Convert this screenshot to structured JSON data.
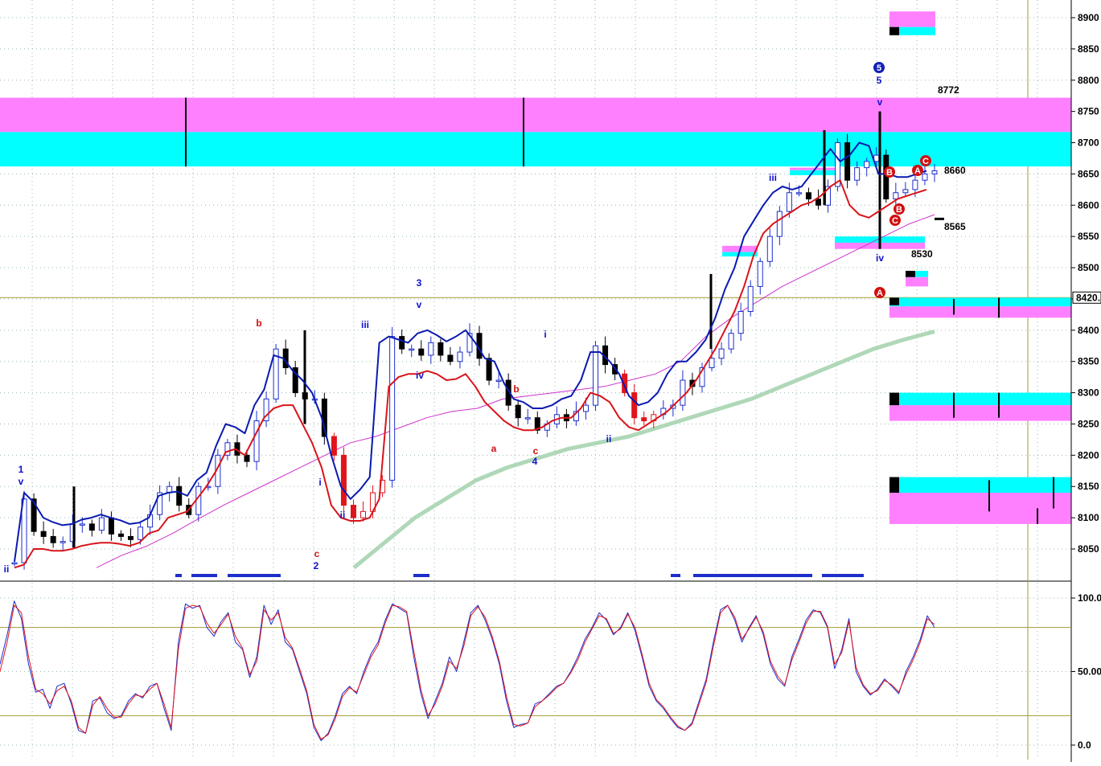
{
  "chart_data": [
    {
      "type": "candlestick",
      "panel": "price",
      "title": "",
      "ylim": [
        8000,
        8920
      ],
      "y_ticks": [
        "8050",
        "8100",
        "8150",
        "8200",
        "8250",
        "8300",
        "8350",
        "8400",
        "8450",
        "8500",
        "8550",
        "8600",
        "8650",
        "8700",
        "8750",
        "8800",
        "8850",
        "8900"
      ],
      "current_price_label": "8420.",
      "current_price": 8420,
      "grid": true,
      "colors": {
        "up_candle": "#1c2fcc",
        "down_candle": "#000000",
        "correction_candle": "#e0141b",
        "band_upper": "#0a1ab0",
        "band_lower": "#d9141b",
        "ma_medium": "#cc33cc",
        "ma_long": "#b0d8b8",
        "zone_magenta": "#ff80ff",
        "zone_cyan": "#00ffff",
        "hline": "#a39a36"
      },
      "horizontal_lines": [
        8420
      ],
      "zones": [
        {
          "from": 8717,
          "to": 8772,
          "color": "magenta"
        },
        {
          "from": 8662,
          "to": 8717,
          "color": "cyan"
        },
        {
          "from": 8885,
          "to": 8910,
          "color": "magenta"
        },
        {
          "from": 8872,
          "to": 8885,
          "color": "cyan"
        },
        {
          "from": 8648,
          "to": 8656,
          "color": "cyan"
        },
        {
          "from": 8530,
          "to": 8550,
          "color": "magenta/cyan"
        },
        {
          "from": 8525,
          "to": 8540,
          "color": "magenta/cyan"
        },
        {
          "from": 8468,
          "to": 8495,
          "color": "magenta/cyan"
        },
        {
          "from": 8420,
          "to": 8452,
          "color": "magenta/cyan"
        },
        {
          "from": 8255,
          "to": 8300,
          "color": "cyan/magenta"
        },
        {
          "from": 8090,
          "to": 8165,
          "color": "cyan/magenta"
        }
      ],
      "price_labels": [
        "8772",
        "8660",
        "8565",
        "8530"
      ],
      "wave_labels": [
        {
          "text": "ii",
          "color": "blue"
        },
        {
          "text": "1",
          "color": "blue"
        },
        {
          "text": "v",
          "color": "blue"
        },
        {
          "text": "b",
          "color": "red"
        },
        {
          "text": "c",
          "color": "red"
        },
        {
          "text": "2",
          "color": "blue"
        },
        {
          "text": "i",
          "color": "blue"
        },
        {
          "text": "ii",
          "color": "blue"
        },
        {
          "text": "iii",
          "color": "blue"
        },
        {
          "text": "3",
          "color": "blue"
        },
        {
          "text": "v",
          "color": "blue"
        },
        {
          "text": "iv",
          "color": "blue"
        },
        {
          "text": "a",
          "color": "red"
        },
        {
          "text": "b",
          "color": "red"
        },
        {
          "text": "c",
          "color": "red"
        },
        {
          "text": "4",
          "color": "blue"
        },
        {
          "text": "i",
          "color": "blue"
        },
        {
          "text": "ii",
          "color": "blue"
        },
        {
          "text": "iii",
          "color": "blue"
        },
        {
          "text": "5",
          "color": "blue"
        },
        {
          "text": "v",
          "color": "blue"
        },
        {
          "text": "iv",
          "color": "blue"
        }
      ],
      "circle_labels": [
        {
          "text": "5",
          "color": "blue"
        },
        {
          "text": "B",
          "color": "red"
        },
        {
          "text": "C",
          "color": "red"
        },
        {
          "text": "A",
          "color": "red"
        },
        {
          "text": "C",
          "color": "red"
        },
        {
          "text": "B",
          "color": "red"
        },
        {
          "text": "A",
          "color": "red"
        }
      ],
      "series_close": [
        8028,
        8130,
        8078,
        8070,
        8060,
        8062,
        8090,
        8090,
        8080,
        8100,
        8074,
        8070,
        8065,
        8085,
        8105,
        8140,
        8150,
        8120,
        8105,
        8150,
        8150,
        8200,
        8220,
        8200,
        8190,
        8255,
        8290,
        8370,
        8340,
        8300,
        8290,
        8290,
        8230,
        8200,
        8120,
        8100,
        8110,
        8140,
        8160,
        8390,
        8370,
        8370,
        8360,
        8380,
        8360,
        8350,
        8365,
        8395,
        8355,
        8320,
        8320,
        8280,
        8260,
        8260,
        8240,
        8250,
        8265,
        8255,
        8270,
        8280,
        8375,
        8345,
        8330,
        8300,
        8260,
        8255,
        8265,
        8275,
        8280,
        8320,
        8310,
        8340,
        8355,
        8370,
        8395,
        8430,
        8470,
        8510,
        8550,
        8590,
        8620,
        8620,
        8610,
        8600,
        8630,
        8700,
        8640,
        8660,
        8670,
        8680,
        8610,
        8620,
        8625,
        8640,
        8650,
        8655
      ],
      "band_upper": [
        8030,
        8140,
        8125,
        8100,
        8093,
        8088,
        8090,
        8097,
        8100,
        8105,
        8100,
        8096,
        8090,
        8092,
        8100,
        8135,
        8140,
        8142,
        8135,
        8160,
        8172,
        8215,
        8250,
        8245,
        8235,
        8280,
        8305,
        8360,
        8355,
        8335,
        8320,
        8300,
        8260,
        8200,
        8150,
        8130,
        8145,
        8165,
        8380,
        8390,
        8385,
        8380,
        8395,
        8400,
        8392,
        8382,
        8390,
        8400,
        8380,
        8355,
        8350,
        8315,
        8290,
        8285,
        8275,
        8275,
        8280,
        8290,
        8295,
        8320,
        8365,
        8365,
        8350,
        8330,
        8295,
        8280,
        8285,
        8300,
        8330,
        8350,
        8350,
        8365,
        8385,
        8420,
        8465,
        8500,
        8550,
        8575,
        8600,
        8620,
        8630,
        8625,
        8630,
        8650,
        8670,
        8690,
        8670,
        8680,
        8700,
        8695,
        8650,
        8650,
        8645,
        8645,
        8650,
        8655
      ],
      "band_lower": [
        8020,
        8025,
        8050,
        8050,
        8047,
        8047,
        8050,
        8055,
        8058,
        8060,
        8060,
        8058,
        8055,
        8060,
        8075,
        8080,
        8100,
        8105,
        8110,
        8130,
        8150,
        8175,
        8205,
        8210,
        8200,
        8230,
        8260,
        8275,
        8280,
        8280,
        8250,
        8220,
        8180,
        8120,
        8100,
        8095,
        8095,
        8100,
        8130,
        8310,
        8325,
        8330,
        8330,
        8335,
        8330,
        8320,
        8322,
        8330,
        8310,
        8285,
        8270,
        8255,
        8245,
        8240,
        8240,
        8245,
        8255,
        8260,
        8260,
        8275,
        8300,
        8295,
        8285,
        8260,
        8245,
        8240,
        8250,
        8260,
        8270,
        8285,
        8300,
        8320,
        8345,
        8370,
        8400,
        8430,
        8470,
        8520,
        8555,
        8570,
        8580,
        8590,
        8600,
        8605,
        8615,
        8630,
        8640,
        8600,
        8585,
        8580,
        8590,
        8600,
        8610,
        8615,
        8620,
        8625
      ],
      "ma_medium_x_start": 120,
      "ma_medium": [
        8020,
        8040,
        8055,
        8075,
        8098,
        8120,
        8140,
        8160,
        8180,
        8200,
        8220,
        8230,
        8245,
        8260,
        8270,
        8275,
        8290,
        8295,
        8300,
        8305,
        8310,
        8320,
        8330,
        8350,
        8390,
        8420,
        8445,
        8470,
        8490,
        8510,
        8530,
        8550,
        8570,
        8585
      ],
      "ma_long_x_start": 440,
      "ma_long": [
        8020,
        8060,
        8100,
        8130,
        8160,
        8180,
        8195,
        8210,
        8220,
        8230,
        8245,
        8260,
        8275,
        8290,
        8310,
        8330,
        8350,
        8370,
        8385,
        8398
      ],
      "highs": [
        8140,
        8220,
        8290,
        8390,
        8430,
        8420,
        8640,
        8660,
        8715,
        8690,
        8750
      ],
      "lows": [
        8020,
        8060,
        8020,
        8145,
        8280,
        8245,
        8300,
        8530,
        8565
      ]
    },
    {
      "type": "line",
      "panel": "oscillator",
      "ylim": [
        0,
        100
      ],
      "y_ticks": [
        "100.0",
        "50.00",
        "0.0"
      ],
      "reference_lines": [
        80,
        20
      ],
      "series": [
        {
          "color": "blue",
          "values": [
            55,
            75,
            98,
            86,
            55,
            36,
            38,
            25,
            40,
            42,
            28,
            10,
            8,
            30,
            32,
            22,
            18,
            20,
            30,
            35,
            32,
            40,
            42,
            25,
            10,
            70,
            96,
            93,
            95,
            80,
            74,
            84,
            90,
            70,
            65,
            46,
            60,
            95,
            82,
            92,
            70,
            65,
            50,
            35,
            12,
            3,
            8,
            20,
            35,
            40,
            35,
            50,
            62,
            70,
            85,
            96,
            93,
            90,
            60,
            35,
            18,
            30,
            42,
            60,
            50,
            70,
            90,
            95,
            85,
            72,
            55,
            30,
            12,
            14,
            15,
            28,
            30,
            35,
            40,
            42,
            50,
            60,
            72,
            80,
            90,
            85,
            75,
            80,
            90,
            78,
            60,
            40,
            30,
            25,
            18,
            12,
            10,
            15,
            30,
            45,
            70,
            92,
            95,
            85,
            70,
            80,
            88,
            75,
            55,
            45,
            40,
            60,
            72,
            85,
            92,
            90,
            80,
            52,
            65,
            86,
            50,
            40,
            34,
            38,
            45,
            40,
            35,
            50,
            60,
            72,
            88,
            80
          ]
        },
        {
          "color": "red",
          "values": [
            50,
            70,
            95,
            90,
            60,
            38,
            35,
            28,
            37,
            40,
            30,
            12,
            8,
            27,
            33,
            25,
            19,
            19,
            28,
            34,
            33,
            38,
            42,
            28,
            12,
            65,
            93,
            95,
            94,
            83,
            76,
            82,
            89,
            74,
            66,
            48,
            57,
            92,
            85,
            90,
            73,
            66,
            52,
            37,
            14,
            4,
            7,
            18,
            33,
            39,
            36,
            48,
            60,
            68,
            83,
            95,
            94,
            91,
            64,
            38,
            20,
            28,
            40,
            57,
            52,
            67,
            88,
            94,
            87,
            74,
            57,
            33,
            14,
            13,
            15,
            26,
            30,
            34,
            39,
            42,
            49,
            58,
            70,
            79,
            88,
            86,
            76,
            79,
            89,
            80,
            62,
            42,
            31,
            26,
            19,
            13,
            10,
            14,
            28,
            43,
            67,
            90,
            95,
            87,
            72,
            79,
            87,
            77,
            57,
            47,
            41,
            58,
            70,
            83,
            91,
            91,
            81,
            55,
            63,
            84,
            53,
            41,
            35,
            37,
            44,
            41,
            36,
            48,
            58,
            70,
            86,
            82
          ]
        }
      ]
    }
  ],
  "volume_bars_color": "#1c2fcc"
}
